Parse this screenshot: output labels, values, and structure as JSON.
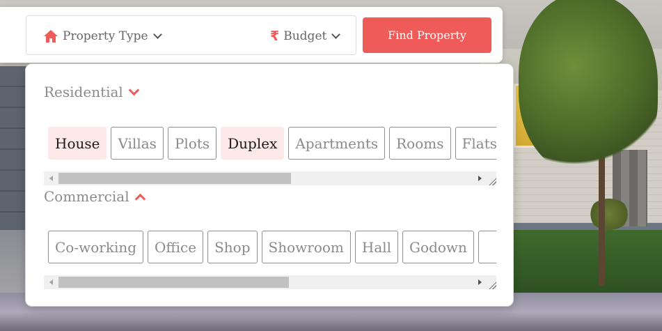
{
  "search": {
    "property_type_label": "Property Type",
    "budget_label": "Budget",
    "budget_symbol": "₹",
    "find_button_label": "Find Property"
  },
  "dropdown": {
    "residential": {
      "heading": "Residential",
      "expanded": false,
      "chips": [
        {
          "label": "House",
          "selected": true
        },
        {
          "label": "Villas",
          "selected": false
        },
        {
          "label": "Plots",
          "selected": false
        },
        {
          "label": "Duplex",
          "selected": true
        },
        {
          "label": "Apartments",
          "selected": false
        },
        {
          "label": "Rooms",
          "selected": false
        },
        {
          "label": "Flats",
          "selected": false
        }
      ]
    },
    "commercial": {
      "heading": "Commercial",
      "expanded": true,
      "chips": [
        {
          "label": "Co-working",
          "selected": false
        },
        {
          "label": "Office",
          "selected": false
        },
        {
          "label": "Shop",
          "selected": false
        },
        {
          "label": "Showroom",
          "selected": false
        },
        {
          "label": "Hall",
          "selected": false
        },
        {
          "label": "Godown",
          "selected": false
        },
        {
          "label": "",
          "selected": false
        }
      ]
    }
  },
  "colors": {
    "accent": "#ef5b58",
    "chip_selected_bg": "#fce8e7"
  },
  "icons": {
    "property_type": "home-icon",
    "budget": "rupee-icon",
    "dropdown": "chevron-down-icon",
    "residential_toggle": "chevron-down-icon",
    "commercial_toggle": "chevron-up-icon"
  }
}
